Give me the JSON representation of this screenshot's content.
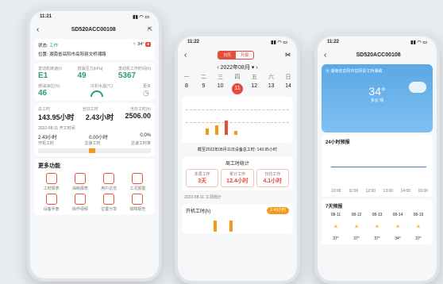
{
  "phone1": {
    "time": "11:21",
    "title": "SD520ACC00108",
    "status_label": "状态:",
    "status_value": "工作",
    "temp": "34°",
    "location_label": "位置:",
    "location_value": "湖南省岳阳市岳阳县文桥湘路",
    "metrics": [
      {
        "label": "发动机转速(r)",
        "value": "E1"
      },
      {
        "label": "燃油压力(kPa)",
        "value": "49"
      },
      {
        "label": "发动机工作时间(h)",
        "value": "5367"
      }
    ],
    "metrics2": [
      {
        "label": "燃油油位(%)",
        "value": "46"
      },
      {
        "label": "冷却水温(℃)",
        "value": ""
      },
      {
        "label": "更多",
        "value": ""
      }
    ],
    "work_labels": [
      "总工时",
      "当日工时",
      "当日工时(h)"
    ],
    "work_values": [
      "143.95小时",
      "2.43小时",
      "2506.00"
    ],
    "date_line": "2022-08-11 开工时间",
    "day_vals": [
      "2.43小时",
      "0.00小时",
      "0.0%"
    ],
    "day_labels": [
      "开机工时",
      "怠速工时",
      "怠速工时率"
    ],
    "more_title": "更多功能",
    "functions": [
      "工时报表",
      "油耗报表",
      "用户总览",
      "工况报警",
      "设备手册",
      "操作视频",
      "位置分享",
      "故障报告"
    ]
  },
  "phone2": {
    "time": "11:22",
    "tabs": [
      "日历",
      "月报"
    ],
    "month": "2022年08月",
    "weekdays": [
      "一",
      "二",
      "三",
      "四",
      "五",
      "六",
      "日"
    ],
    "days": [
      "8",
      "9",
      "10",
      "11",
      "12",
      "13",
      "14"
    ],
    "selected_day": "11",
    "note": "截至2022年08月11日设备总工时: 143.95小时",
    "week_title": "周工时统计",
    "stats": [
      {
        "label": "本周工作",
        "value": "3天"
      },
      {
        "label": "累计工作",
        "value": "12.4小时"
      },
      {
        "label": "日均工作",
        "value": "4.1小时"
      }
    ],
    "detail_date": "2022-08-11 工况统计",
    "detail_label": "开机工时(h)",
    "detail_value": "2.43小时"
  },
  "phone3": {
    "time": "11:22",
    "title": "SD520ACC00108",
    "location": "湖南省岳阳市岳阳县文桥湘路",
    "temp": "34°",
    "cond": "多云 晴",
    "forecast24_title": "24小时预报",
    "hours": [
      "10:00",
      "11:00",
      "12:00",
      "13:00",
      "14:00",
      "15:00"
    ],
    "seven_title": "7天预报",
    "dates": [
      "08-11",
      "08-12",
      "08-13",
      "08-14",
      "08-15"
    ],
    "temps": [
      "37°",
      "37°",
      "37°",
      "34°",
      "37°"
    ]
  }
}
